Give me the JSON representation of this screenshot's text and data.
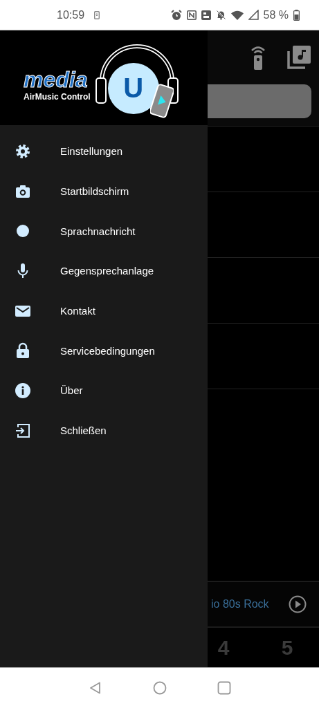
{
  "status_bar": {
    "time": "10:59",
    "battery": "58 %"
  },
  "player": {
    "title": "io 80s Rock"
  },
  "presets": [
    "4",
    "5"
  ],
  "drawer": {
    "logo": {
      "word": "media",
      "letter": "U",
      "subtitle": "AirMusic Control"
    },
    "items": [
      {
        "label": "Einstellungen"
      },
      {
        "label": "Startbildschirm"
      },
      {
        "label": "Sprachnachricht"
      },
      {
        "label": "Gegensprechanlage"
      },
      {
        "label": "Kontakt"
      },
      {
        "label": "Servicebedingungen"
      },
      {
        "label": "Über"
      },
      {
        "label": "Schließen"
      }
    ]
  }
}
